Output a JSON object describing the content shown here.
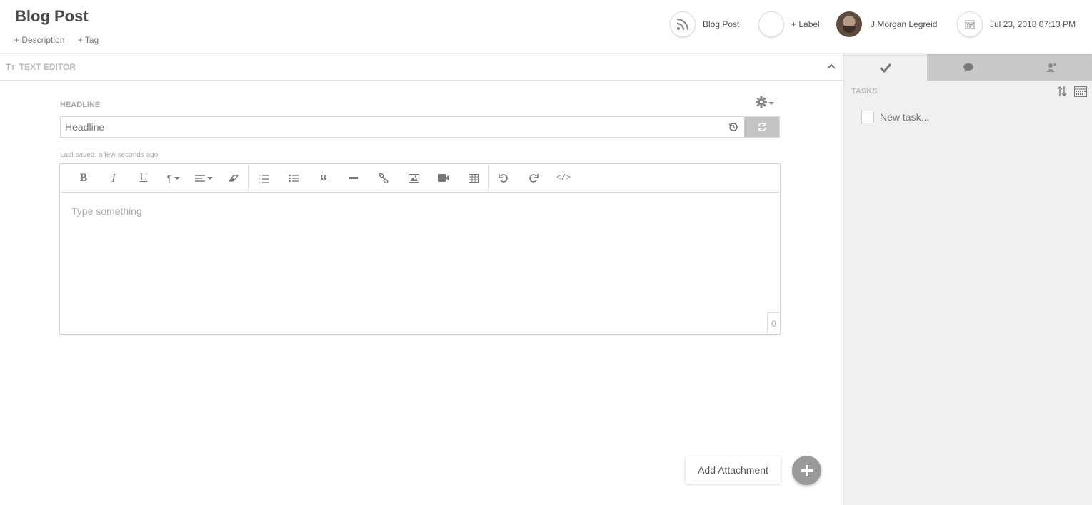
{
  "header": {
    "title": "Blog Post",
    "add_description": "+ Description",
    "add_tag": "+ Tag",
    "type_label": "Blog Post",
    "add_label": "+ Label",
    "assignee": "J.Morgan Legreid",
    "date": "Jul 23, 2018 07:13 PM"
  },
  "editor": {
    "section_label": "TEXT EDITOR",
    "section_icon_text": "TT",
    "headline_label": "HEADLINE",
    "headline_placeholder": "Headline",
    "last_saved": "Last saved: a few seconds ago",
    "body_placeholder": "Type something",
    "char_count": "0",
    "toolbar": [
      "bold",
      "italic",
      "underline",
      "paragraph",
      "align",
      "clear-format",
      "ordered-list",
      "unordered-list",
      "quote",
      "horizontal-rule",
      "link",
      "image",
      "video",
      "table",
      "undo",
      "redo",
      "code"
    ]
  },
  "actions": {
    "add_attachment": "Add Attachment"
  },
  "sidebar": {
    "tabs": [
      "tasks",
      "comments",
      "users"
    ],
    "tasks_label": "TASKS",
    "new_task": "New task..."
  },
  "colors": {
    "accent_gray": "#9a9a9a",
    "panel_bg": "#f0f0f0",
    "tab_bg": "#c9c9c9"
  }
}
